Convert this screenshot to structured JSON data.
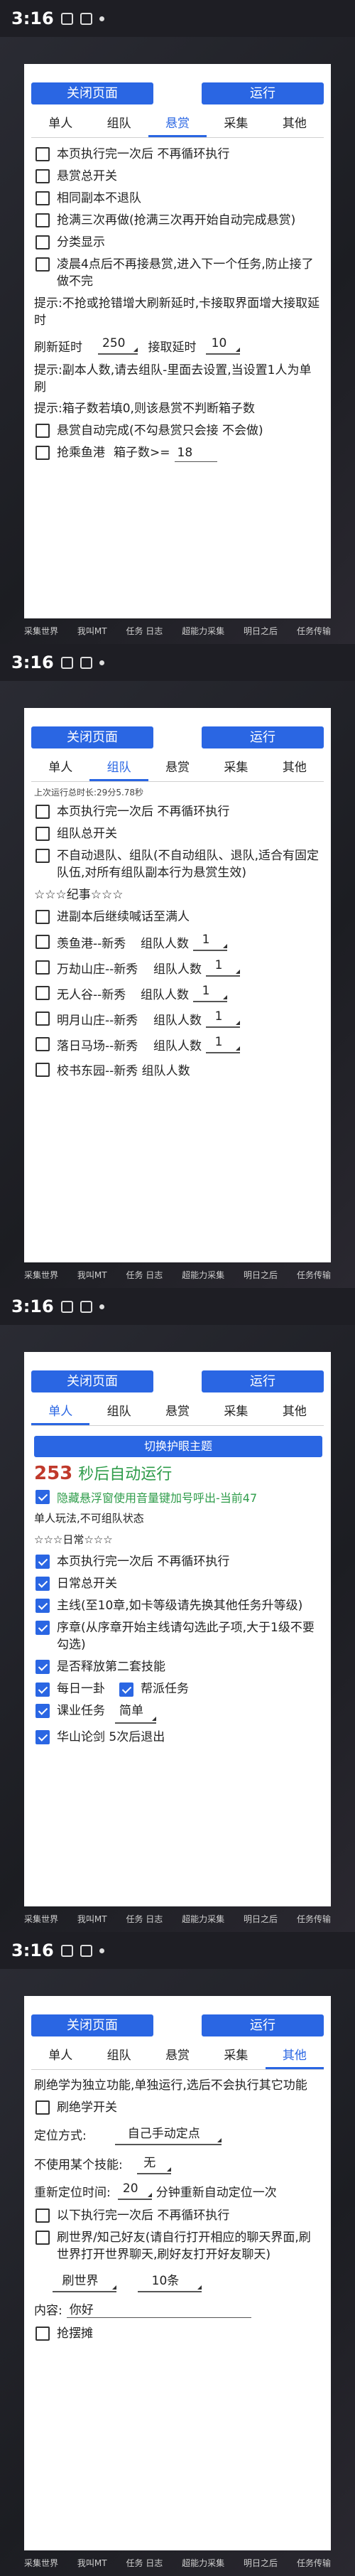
{
  "status_time": "3:16",
  "buttons": {
    "close": "关闭页面",
    "run": "运行"
  },
  "tabs": [
    "单人",
    "组队",
    "悬赏",
    "采集",
    "其他"
  ],
  "bottom_bar": [
    "采集世界",
    "我叫MT",
    "任务 日志",
    "超能力采集",
    "明日之后",
    "任务传输"
  ],
  "screen1": {
    "active_tab": "悬赏",
    "cb1": "本页执行完一次后 不再循环执行",
    "cb2": "悬赏总开关",
    "cb3": "相同副本不退队",
    "cb4": "抢满三次再做(抢满三次再开始自动完成悬赏)",
    "cb5": "分类显示",
    "cb6": "凌晨4点后不再接悬赏,进入下一个任务,防止接了做不完",
    "tip1": "提示:不抢或抢错增大刷新延时,卡接取界面增大接取延时",
    "refresh_label": "刷新延时",
    "refresh_value": "250",
    "accept_label": "接取延时",
    "accept_value": "10",
    "tip2": "提示:副本人数,请去组队-里面去设置,当设置1人为单刷",
    "tip3": "提示:箱子数若填0,则该悬赏不判断箱子数",
    "cb7": "悬赏自动完成(不勾悬赏只会接 不会做)",
    "cb8": "抢乘鱼港",
    "box_label": "箱子数>=",
    "box_value": "18"
  },
  "screen2": {
    "active_tab": "组队",
    "runtime": "上次运行总时长:29分5.78秒",
    "cb1": "本页执行完一次后 不再循环执行",
    "cb2": "组队总开关",
    "cb3": "不自动退队、组队(不自动组队、退队,适合有固定队伍,对所有组队副本行为悬赏生效)",
    "section": "☆☆☆纪事☆☆☆",
    "cb4": "进副本后继续喊话至满人",
    "dungeons": [
      {
        "name": "羡鱼港--新秀",
        "count_label": "组队人数",
        "count": "1"
      },
      {
        "name": "万劫山庄--新秀",
        "count_label": "组队人数",
        "count": "1"
      },
      {
        "name": "无人谷--新秀",
        "count_label": "组队人数",
        "count": "1"
      },
      {
        "name": "明月山庄--新秀",
        "count_label": "组队人数",
        "count": "1"
      },
      {
        "name": "落日马场--新秀",
        "count_label": "组队人数",
        "count": "1"
      }
    ],
    "cut_item": "校书东园--新秀  组队人数"
  },
  "screen3": {
    "active_tab": "单人",
    "theme_btn": "切换护眼主题",
    "countdown": "253",
    "countdown_label": "秒后自动运行",
    "hide_tip": "隐藏悬浮窗使用音量键加号呼出-当前47",
    "note": "单人玩法,不可组队状态",
    "section": "☆☆☆日常☆☆☆",
    "cb1": "本页执行完一次后 不再循环执行",
    "cb2": "日常总开关",
    "cb3": "主线(至10章,如卡等级请先换其他任务升等级)",
    "cb4": "序章(从序章开始主线请勾选此子项,大于1级不要勾选)",
    "cb5": "是否释放第二套技能",
    "cb6": "每日一卦",
    "cb7": "帮派任务",
    "cb8": "课业任务",
    "difficulty": "简单",
    "cut_item": "华山论剑 5次后退出"
  },
  "screen4": {
    "active_tab": "其他",
    "intro": "刷绝学为独立功能,单独运行,选后不会执行其它功能",
    "cb1": "刷绝学开关",
    "locate_label": "定位方式:",
    "locate_value": "自己手动定点",
    "skill_label": "不使用某个技能:",
    "skill_value": "无",
    "relocate_label": "重新定位时间:",
    "relocate_value": "20",
    "relocate_suffix": "分钟重新自动定位一次",
    "cb2": "以下执行完一次后 不再循环执行",
    "cb3": "刷世界/知己好友(请自行打开相应的聊天界面,刷世界打开世界聊天,刷好友打开好友聊天)",
    "channel_value": "刷世界",
    "count_value": "10条",
    "content_label": "内容:",
    "content_value": "你好",
    "cut_item": "抢摆摊"
  }
}
